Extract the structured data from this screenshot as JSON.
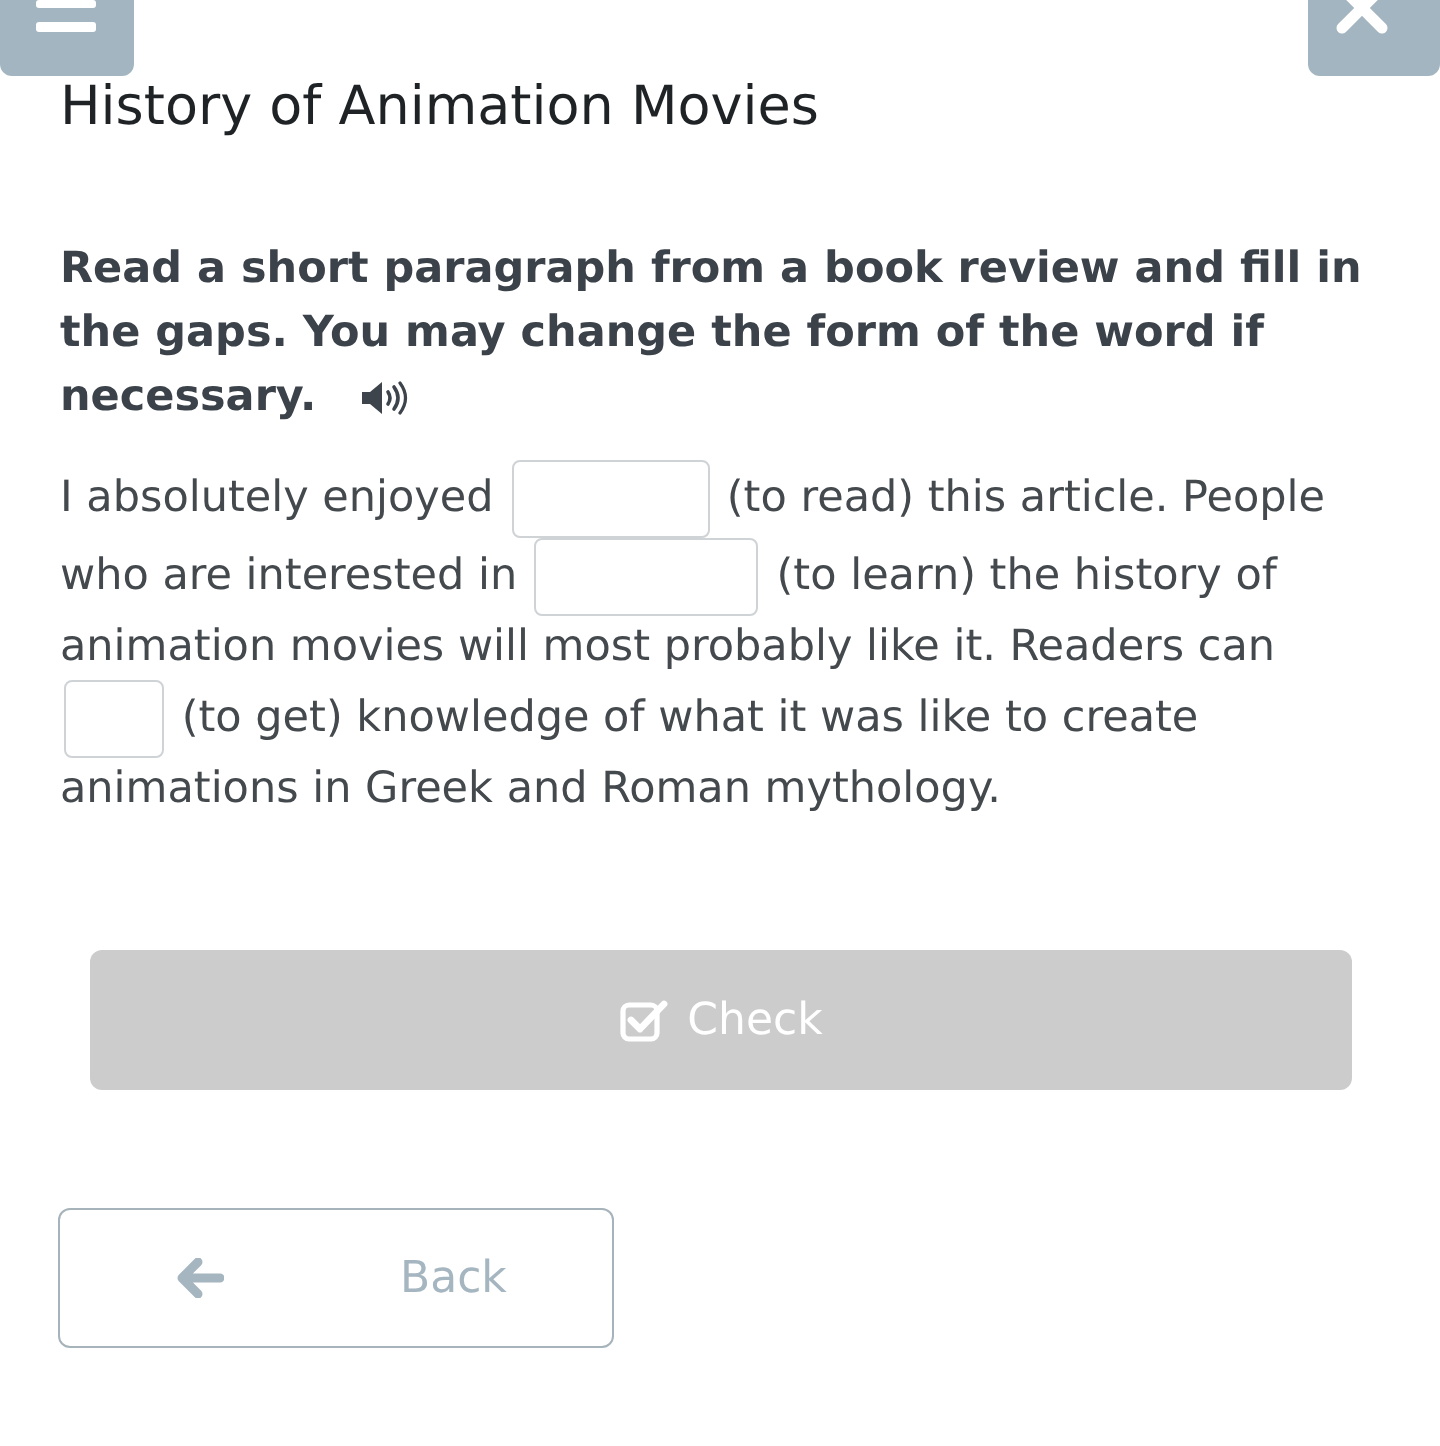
{
  "title": "History of Animation Movies",
  "instruction": [
    "Read a short paragraph from a book review and fill in",
    "the gaps. You may change the form of the word if",
    "necessary."
  ],
  "passage": [
    {
      "kind": "text",
      "text": "I absolutely enjoyed"
    },
    {
      "kind": "gap"
    },
    {
      "kind": "text",
      "text": "(to read) this article. People"
    },
    {
      "kind": "text",
      "text": "who are interested in"
    },
    {
      "kind": "gap"
    },
    {
      "kind": "text",
      "text": "(to learn) the history of"
    },
    {
      "kind": "text",
      "text": "animation movies will most probably like it. Readers can"
    },
    {
      "kind": "gap"
    },
    {
      "kind": "text",
      "text": "(to get) knowledge of what it was like to create"
    },
    {
      "kind": "text",
      "text": "animations in Greek and Roman mythology."
    }
  ],
  "check_button": {
    "label": "Check",
    "disabled": true
  },
  "back_button": {
    "label": "Back"
  }
}
